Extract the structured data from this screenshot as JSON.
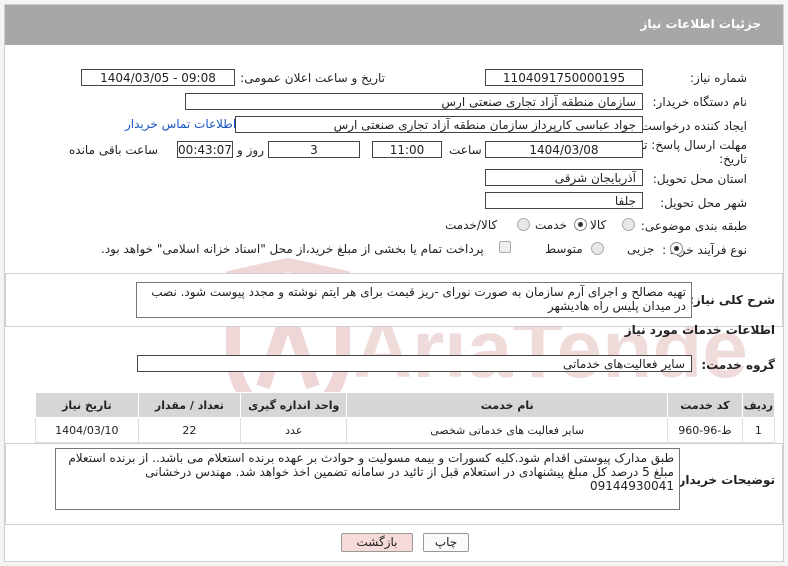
{
  "header": {
    "title": "جزئیات اطلاعات نیاز"
  },
  "form": {
    "need_number_label": "شماره نیاز:",
    "need_number": "1104091750000195",
    "announce_label": "تاریخ و ساعت اعلان عمومی:",
    "announce_value": "1404/03/05 - 09:08",
    "buyer_org_label": "نام دستگاه خریدار:",
    "buyer_org": "سازمان منطقه آزاد تجاری صنعتی ارس",
    "creator_label": "ایجاد کننده درخواست:",
    "creator": "جواد عباسی کارپرداز سازمان منطقه آزاد تجاری صنعتی ارس",
    "contact_link": "اطلاعات تماس خریدار",
    "deadline_label_1": "مهلت ارسال پاسخ: تا",
    "deadline_label_2": "تاریخ:",
    "deadline_date": "1404/03/08",
    "time_label": "ساعت",
    "deadline_time": "11:00",
    "days_value": "3",
    "days_label": "روز و",
    "remaining_time": "00:43:07",
    "remaining_label": "ساعت باقی مانده",
    "province_label": "استان محل تحویل:",
    "province": "آذربایجان شرقی",
    "city_label": "شهر محل تحویل:",
    "city": "جلفا",
    "category_label": "طبقه بندی موضوعی:",
    "category_options": [
      "کالا",
      "خدمت",
      "کالا/خدمت"
    ],
    "category_selected": "خدمت",
    "process_label": "نوع فرآیند خرید :",
    "process_options": [
      "جزیی",
      "متوسط"
    ],
    "process_selected": "جزیی",
    "treasury_note": "پرداخت تمام یا بخشی از مبلغ خرید،از محل \"اسناد خزانه اسلامی\" خواهد بود."
  },
  "description": {
    "label": "شرح کلی نیاز:",
    "text": "تهیه مصالح و اجرای آرم سازمان به صورت نورای -ریز قیمت برای هر ایتم نوشته و مجدد پیوست شود. نصب در میدان پلیس راه هادیشهر"
  },
  "services": {
    "section_title": "اطلاعات خدمات مورد نیاز",
    "group_label": "گروه خدمت:",
    "group_value": "سایر فعالیت‌های خدماتی",
    "columns": [
      "ردیف",
      "کد خدمت",
      "نام خدمت",
      "واحد اندازه گیری",
      "تعداد / مقدار",
      "تاریخ نیاز"
    ],
    "rows": [
      {
        "row": "1",
        "code": "ط-96-960",
        "name": "سایر فعالیت های خدماتی شخصی",
        "unit": "عدد",
        "qty": "22",
        "date": "1404/03/10"
      }
    ]
  },
  "buyer_notes": {
    "label": "توضیحات خریدار:",
    "text": "طبق مدارک پیوستی اقدام شود.کلیه کسورات و بیمه مسولیت و حوادث بر عهده برنده استعلام می باشد.. از برنده استعلام مبلغ 5 درصد کل مبلغ پیشنهادی در استعلام قبل از تائید در سامانه تضمین اخذ خواهد شد. مهندس درخشانی 09144930041"
  },
  "buttons": {
    "print": "چاپ",
    "back": "بازگشت"
  },
  "watermark": {
    "text": "AriaTender.neT"
  },
  "colors": {
    "header_bg": "#a7a7a7",
    "link": "#1a56c4",
    "back_btn_bg": "#f6dada",
    "watermark": "#e2b8b8"
  },
  "icons": {
    "watermark_logo": "shield-logo"
  }
}
